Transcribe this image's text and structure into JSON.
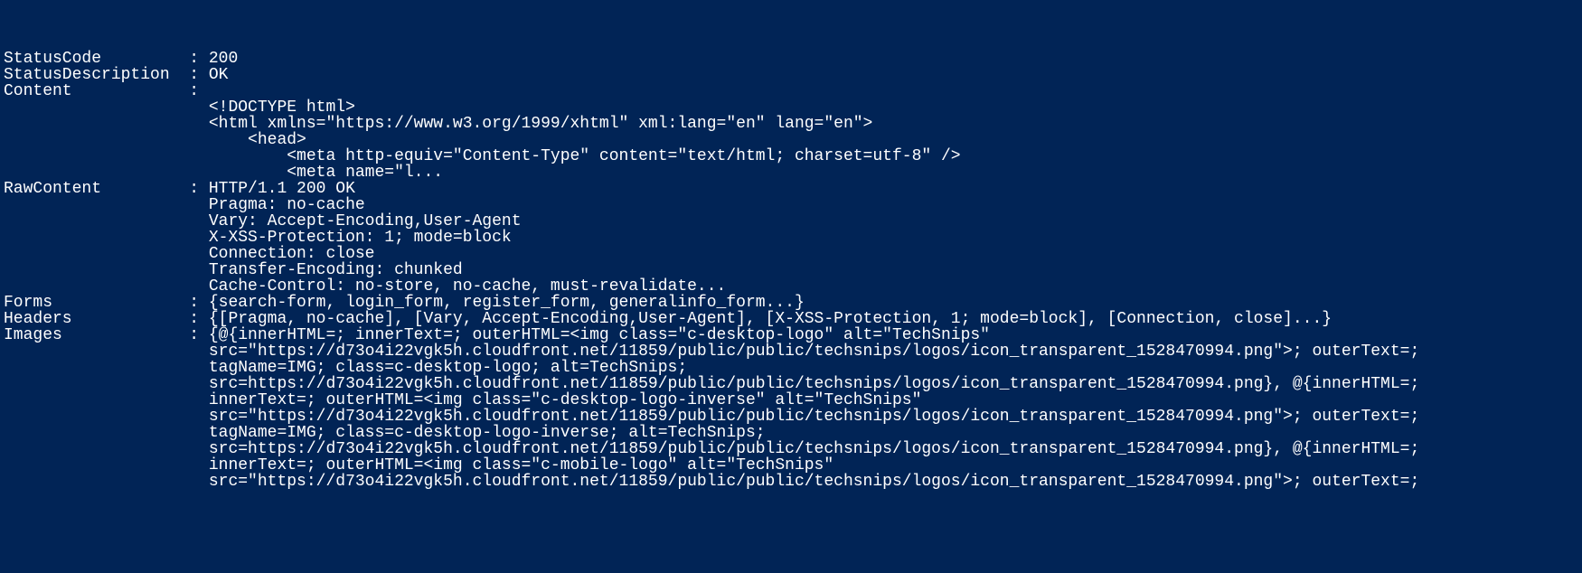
{
  "output": {
    "cols": {
      "keyWidth": 19
    },
    "rows": [
      {
        "key": "StatusCode",
        "value": "200"
      },
      {
        "key": "StatusDescription",
        "value": "OK"
      },
      {
        "key": "Content",
        "value": ""
      },
      {
        "cont": "<!DOCTYPE html>"
      },
      {
        "cont": "<html xmlns=\"https://www.w3.org/1999/xhtml\" xml:lang=\"en\" lang=\"en\">"
      },
      {
        "cont": "    <head>"
      },
      {
        "cont": "        <meta http-equiv=\"Content-Type\" content=\"text/html; charset=utf-8\" />"
      },
      {
        "cont": "        <meta name=\"l..."
      },
      {
        "key": "RawContent",
        "value": "HTTP/1.1 200 OK"
      },
      {
        "cont": "Pragma: no-cache"
      },
      {
        "cont": "Vary: Accept-Encoding,User-Agent"
      },
      {
        "cont": "X-XSS-Protection: 1; mode=block"
      },
      {
        "cont": "Connection: close"
      },
      {
        "cont": "Transfer-Encoding: chunked"
      },
      {
        "cont": "Cache-Control: no-store, no-cache, must-revalidate..."
      },
      {
        "key": "Forms",
        "value": "{search-form, login_form, register_form, generalinfo_form...}"
      },
      {
        "key": "Headers",
        "value": "{[Pragma, no-cache], [Vary, Accept-Encoding,User-Agent], [X-XSS-Protection, 1; mode=block], [Connection, close]...}"
      },
      {
        "key": "Images",
        "value": "{@{innerHTML=; innerText=; outerHTML=<img class=\"c-desktop-logo\" alt=\"TechSnips\""
      },
      {
        "cont": "src=\"https://d73o4i22vgk5h.cloudfront.net/11859/public/public/techsnips/logos/icon_transparent_1528470994.png\">; outerText=;"
      },
      {
        "cont": "tagName=IMG; class=c-desktop-logo; alt=TechSnips;"
      },
      {
        "cont": "src=https://d73o4i22vgk5h.cloudfront.net/11859/public/public/techsnips/logos/icon_transparent_1528470994.png}, @{innerHTML=;"
      },
      {
        "cont": "innerText=; outerHTML=<img class=\"c-desktop-logo-inverse\" alt=\"TechSnips\""
      },
      {
        "cont": "src=\"https://d73o4i22vgk5h.cloudfront.net/11859/public/public/techsnips/logos/icon_transparent_1528470994.png\">; outerText=;"
      },
      {
        "cont": "tagName=IMG; class=c-desktop-logo-inverse; alt=TechSnips;"
      },
      {
        "cont": "src=https://d73o4i22vgk5h.cloudfront.net/11859/public/public/techsnips/logos/icon_transparent_1528470994.png}, @{innerHTML=;"
      },
      {
        "cont": "innerText=; outerHTML=<img class=\"c-mobile-logo\" alt=\"TechSnips\""
      },
      {
        "cont": "src=\"https://d73o4i22vgk5h.cloudfront.net/11859/public/public/techsnips/logos/icon_transparent_1528470994.png\">; outerText=;"
      }
    ]
  }
}
